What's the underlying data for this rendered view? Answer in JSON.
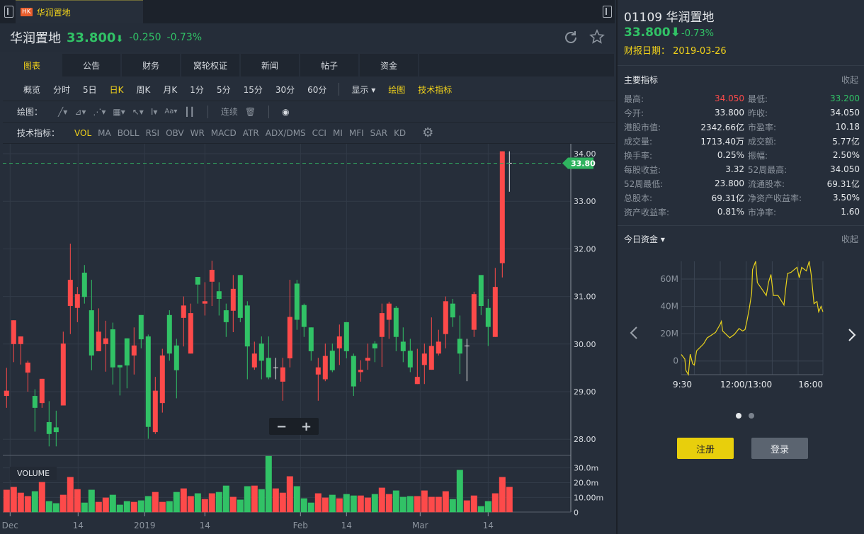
{
  "window": {
    "tab_badge": "HK",
    "tab_title": "华润置地"
  },
  "header": {
    "name": "华润置地",
    "price": "33.800",
    "arrow": "⬇",
    "change": "-0.250",
    "change_pct": "-0.73%"
  },
  "tabs": [
    "图表",
    "公告",
    "财务",
    "窝轮权证",
    "新闻",
    "帖子",
    "资金"
  ],
  "periods": [
    "概览",
    "分时",
    "5日",
    "日K",
    "周K",
    "月K",
    "1分",
    "5分",
    "15分",
    "30分",
    "60分"
  ],
  "period_active": "日K",
  "display_menu": "显示",
  "draw_link": "绘图",
  "indicator_link": "技术指标",
  "draw_row": {
    "label": "绘图：",
    "continuous": "连续"
  },
  "indicator_row": {
    "label": "技术指标：",
    "items": [
      "VOL",
      "MA",
      "BOLL",
      "RSI",
      "OBV",
      "WR",
      "MACD",
      "ATR",
      "ADX/DMS",
      "CCI",
      "MI",
      "MFI",
      "SAR",
      "KD"
    ]
  },
  "colors": {
    "up": "#fd4a4a",
    "down": "#31c266",
    "doji": "#e8e8e8",
    "accent": "#f1d21b",
    "fund_line": "#e9d21c"
  },
  "chart_data": {
    "type": "candlestick",
    "ohlc": [
      [
        28.91,
        29.5,
        28.66,
        29.02
      ],
      [
        30.0,
        30.5,
        29.62,
        30.5
      ],
      [
        30.0,
        30.16,
        29.57,
        30.16
      ],
      [
        29.4,
        29.65,
        29.0,
        29.61
      ],
      [
        28.91,
        29.05,
        28.16,
        28.66
      ],
      [
        28.76,
        29.27,
        28.66,
        29.27
      ],
      [
        28.36,
        28.8,
        27.85,
        28.11
      ],
      [
        28.25,
        28.6,
        27.85,
        28.15
      ],
      [
        28.71,
        30.26,
        28.71,
        30.01
      ],
      [
        30.8,
        32.11,
        30.21,
        31.35
      ],
      [
        30.76,
        31.2,
        30.46,
        31.05
      ],
      [
        31.5,
        31.66,
        30.85,
        30.99
      ],
      [
        30.71,
        31.35,
        29.45,
        29.76
      ],
      [
        29.85,
        30.75,
        29.85,
        30.26
      ],
      [
        30.0,
        30.49,
        29.42,
        30.12
      ],
      [
        30.31,
        30.45,
        29.15,
        29.51
      ],
      [
        29.56,
        29.56,
        28.92,
        29.51
      ],
      [
        30.12,
        30.12,
        29.07,
        29.55
      ],
      [
        29.76,
        30.35,
        29.36,
        29.97
      ],
      [
        30.61,
        30.61,
        29.91,
        30.1
      ],
      [
        30.16,
        30.2,
        28.01,
        28.26
      ],
      [
        28.15,
        29.31,
        28.11,
        29.02
      ],
      [
        28.76,
        29.9,
        28.56,
        29.76
      ],
      [
        30.61,
        30.71,
        29.65,
        29.8
      ],
      [
        29.97,
        30.11,
        28.86,
        29.45
      ],
      [
        30.55,
        31.0,
        29.95,
        30.81
      ],
      [
        29.8,
        30.85,
        29.8,
        30.65
      ],
      [
        31.41,
        31.41,
        30.85,
        31.25
      ],
      [
        30.85,
        31.3,
        30.6,
        30.9
      ],
      [
        31.31,
        31.75,
        30.8,
        31.56
      ],
      [
        31.11,
        31.3,
        30.6,
        30.95
      ],
      [
        30.71,
        30.85,
        30.15,
        30.46
      ],
      [
        30.7,
        31.45,
        30.25,
        31.16
      ],
      [
        31.45,
        31.45,
        30.46,
        30.55
      ],
      [
        30.81,
        30.9,
        29.26,
        29.95
      ],
      [
        29.51,
        30.05,
        29.46,
        29.8
      ],
      [
        30.01,
        30.16,
        29.26,
        29.65
      ],
      [
        29.71,
        30.16,
        29.26,
        29.3
      ],
      [
        29.5,
        29.71,
        29.26,
        29.5
      ],
      [
        29.21,
        29.71,
        28.81,
        29.51
      ],
      [
        29.7,
        31.35,
        29.51,
        30.57
      ],
      [
        31.27,
        31.35,
        30.3,
        30.51
      ],
      [
        30.82,
        30.85,
        30.15,
        30.36
      ],
      [
        30.35,
        30.35,
        29.65,
        29.85
      ],
      [
        29.36,
        29.71,
        28.81,
        29.51
      ],
      [
        29.26,
        30.01,
        29.22,
        29.75
      ],
      [
        29.86,
        30.01,
        29.41,
        29.45
      ],
      [
        29.91,
        30.41,
        29.56,
        30.16
      ],
      [
        30.46,
        30.46,
        29.7,
        29.85
      ],
      [
        29.75,
        29.8,
        28.91,
        29.11
      ],
      [
        29.41,
        29.66,
        29.21,
        29.46
      ],
      [
        29.65,
        30.01,
        29.46,
        29.71
      ],
      [
        30.01,
        30.06,
        29.62,
        29.91
      ],
      [
        30.15,
        30.85,
        29.52,
        30.65
      ],
      [
        30.51,
        30.89,
        30.11,
        30.85
      ],
      [
        30.76,
        30.8,
        29.85,
        30.15
      ],
      [
        30.05,
        30.35,
        29.62,
        29.85
      ],
      [
        29.86,
        30.11,
        29.41,
        29.51
      ],
      [
        29.16,
        29.9,
        29.16,
        29.31
      ],
      [
        29.56,
        30.01,
        29.16,
        29.8
      ],
      [
        29.46,
        30.56,
        29.46,
        29.96
      ],
      [
        29.8,
        30.3,
        29.76,
        30.05
      ],
      [
        30.21,
        31.0,
        29.91,
        30.9
      ],
      [
        30.85,
        30.95,
        30.36,
        30.56
      ],
      [
        30.11,
        30.6,
        29.37,
        29.8
      ],
      [
        29.96,
        30.11,
        29.22,
        29.96
      ],
      [
        30.3,
        31.1,
        30.15,
        31.05
      ],
      [
        31.45,
        31.45,
        30.61,
        30.8
      ],
      [
        30.76,
        30.95,
        29.96,
        30.36
      ],
      [
        30.15,
        31.6,
        30.15,
        31.2
      ],
      [
        31.7,
        34.05,
        31.4,
        34.05
      ],
      [
        33.8,
        34.05,
        33.2,
        33.8
      ]
    ],
    "volume_m": [
      15.2,
      17.1,
      13.2,
      10.9,
      14.2,
      20.4,
      7.5,
      6.1,
      11.8,
      23.8,
      15.6,
      6.5,
      15.2,
      7.0,
      9.9,
      11.8,
      5.1,
      7.5,
      7.0,
      8.0,
      10.9,
      13.7,
      7.0,
      7.5,
      13.7,
      16.1,
      10.9,
      12.8,
      8.9,
      12.8,
      13.7,
      18.0,
      10.4,
      8.5,
      17.6,
      18.0,
      15.6,
      38.0,
      16.1,
      13.2,
      24.3,
      17.6,
      9.4,
      6.5,
      12.8,
      9.9,
      11.8,
      9.4,
      12.3,
      11.3,
      11.3,
      9.9,
      12.3,
      16.6,
      12.3,
      14.7,
      10.4,
      10.9,
      10.9,
      14.7,
      10.4,
      10.4,
      14.2,
      8.9,
      28.6,
      8.0,
      11.3,
      4.1,
      7.5,
      12.8,
      23.8,
      17.1
    ],
    "y_ticks": [
      "28.00",
      "29.00",
      "30.00",
      "31.00",
      "32.00",
      "33.00",
      "34.00"
    ],
    "ylim": [
      27.8,
      34.2
    ],
    "last_price_label": "33.80",
    "last_price": 33.8,
    "volume_label": "VOLUME",
    "volume_ticks": [
      {
        "v": 0,
        "label": "0"
      },
      {
        "v": 10,
        "label": "10.00m"
      },
      {
        "v": 20,
        "label": "20.0m"
      },
      {
        "v": 30,
        "label": "30.0m"
      }
    ],
    "x_ticks": [
      {
        "i": 0.5,
        "label": "Dec"
      },
      {
        "i": 10.1,
        "label": "14"
      },
      {
        "i": 19.5,
        "label": "2019"
      },
      {
        "i": 28,
        "label": "14"
      },
      {
        "i": 41.5,
        "label": "Feb"
      },
      {
        "i": 48,
        "label": "14"
      },
      {
        "i": 58.4,
        "label": "Mar"
      },
      {
        "i": 68,
        "label": "14"
      }
    ]
  },
  "zoom": {
    "minus": "−",
    "plus": "+"
  },
  "right": {
    "title": "01109 华润置地",
    "price": "33.800⬇",
    "pct": "-0.73%",
    "report_date": "财报日期： 2019-03-26",
    "metrics_title": "主要指标",
    "collapse": "收起",
    "metrics": [
      [
        "最高:",
        "34.050",
        "最低:",
        "33.200"
      ],
      [
        "今开:",
        "33.800",
        "昨收:",
        "34.050"
      ],
      [
        "港股市值:",
        "2342.66亿",
        "市盈率:",
        "10.18"
      ],
      [
        "成交量:",
        "1713.40万",
        "成交额:",
        "5.77亿"
      ],
      [
        "换手率:",
        "0.25%",
        "振幅:",
        "2.50%"
      ],
      [
        "每股收益:",
        "3.32",
        "52周最高:",
        "34.050"
      ],
      [
        "52周最低:",
        "23.800",
        "流通股本:",
        "69.31亿"
      ],
      [
        "总股本:",
        "69.31亿",
        "净资产收益率:",
        "3.50%"
      ],
      [
        "资产收益率:",
        "0.81%",
        "市净率:",
        "1.60"
      ]
    ],
    "fund_title": "今日资金 ▾",
    "fund_collapse": "收起",
    "fund_chart": {
      "type": "line",
      "y_ticks": [
        {
          "v": 0,
          "label": "0"
        },
        {
          "v": 20,
          "label": "20M"
        },
        {
          "v": 40,
          "label": "40M"
        },
        {
          "v": 60,
          "label": "60M"
        }
      ],
      "ylim": [
        -10,
        73
      ],
      "x_labels": [
        "9:30",
        "12:00/13:00",
        "16:00"
      ],
      "points": [
        [
          0,
          4.8
        ],
        [
          0.025,
          1.4
        ],
        [
          0.033,
          -7
        ],
        [
          0.05,
          -10
        ],
        [
          0.063,
          5
        ],
        [
          0.08,
          -2
        ],
        [
          0.092,
          -3
        ],
        [
          0.108,
          7.4
        ],
        [
          0.133,
          10
        ],
        [
          0.158,
          12.6
        ],
        [
          0.183,
          17
        ],
        [
          0.208,
          18.6
        ],
        [
          0.242,
          21
        ],
        [
          0.275,
          27
        ],
        [
          0.283,
          29
        ],
        [
          0.292,
          22
        ],
        [
          0.317,
          19.5
        ],
        [
          0.342,
          17
        ],
        [
          0.375,
          19.5
        ],
        [
          0.408,
          23.8
        ],
        [
          0.433,
          22
        ],
        [
          0.45,
          23
        ],
        [
          0.463,
          29
        ],
        [
          0.48,
          38.4
        ],
        [
          0.497,
          49.7
        ],
        [
          0.503,
          67
        ],
        [
          0.525,
          73
        ],
        [
          0.537,
          57.4
        ],
        [
          0.567,
          53
        ],
        [
          0.6,
          48
        ],
        [
          0.617,
          58
        ],
        [
          0.633,
          63.4
        ],
        [
          0.65,
          48
        ],
        [
          0.683,
          48
        ],
        [
          0.725,
          41
        ],
        [
          0.737,
          53
        ],
        [
          0.75,
          64
        ],
        [
          0.775,
          65
        ],
        [
          0.817,
          68.6
        ],
        [
          0.833,
          61
        ],
        [
          0.85,
          68.6
        ],
        [
          0.883,
          66
        ],
        [
          0.903,
          73
        ],
        [
          0.917,
          63.4
        ],
        [
          0.937,
          42
        ],
        [
          0.958,
          43.6
        ],
        [
          0.97,
          36
        ],
        [
          0.987,
          40
        ],
        [
          1,
          36
        ]
      ]
    },
    "register": "注册",
    "login": "登录"
  }
}
